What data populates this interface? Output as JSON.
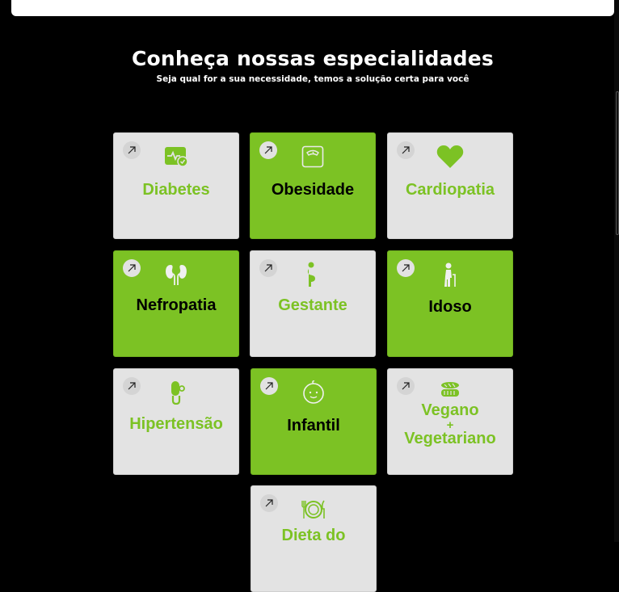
{
  "header": {
    "title": "Conheça nossas especialidades",
    "subtitle": "Seja qual for a sua necessidade, temos a solução certa para você"
  },
  "colors": {
    "accent_green": "#7cc224",
    "card_light": "#e3e3e3",
    "background": "#000000"
  },
  "cards": [
    {
      "label": "Diabetes",
      "style": "light",
      "icon": "glucose-meter-icon"
    },
    {
      "label": "Obesidade",
      "style": "green",
      "icon": "weight-scale-icon"
    },
    {
      "label": "Cardiopatia",
      "style": "light",
      "icon": "heart-icon"
    },
    {
      "label": "Nefropatia",
      "style": "green",
      "icon": "kidneys-icon"
    },
    {
      "label": "Gestante",
      "style": "light",
      "icon": "pregnant-icon"
    },
    {
      "label": "Idoso",
      "style": "green",
      "icon": "elderly-icon"
    },
    {
      "label": "Hipertensão",
      "style": "light",
      "icon": "blood-pressure-icon"
    },
    {
      "label": "Infantil",
      "style": "green",
      "icon": "baby-icon"
    },
    {
      "label_line1": "Vegano",
      "label_plus": "+",
      "label_line2": "Vegetariano",
      "style": "light",
      "icon": "vegetables-icon"
    },
    {
      "label": "Dieta do",
      "style": "light",
      "icon": "plate-cutlery-icon"
    }
  ]
}
